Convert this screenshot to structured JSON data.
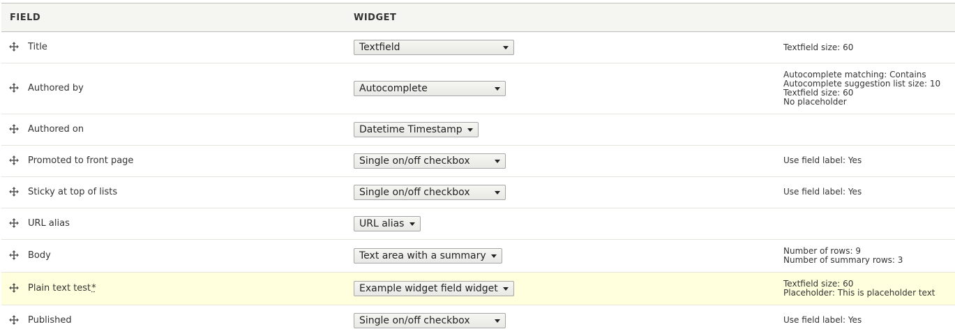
{
  "header": {
    "field": "FIELD",
    "widget": "WIDGET"
  },
  "rows": [
    {
      "label": "Title",
      "widget": "Textfield",
      "summary": [
        "Textfield size: 60"
      ]
    },
    {
      "label": "Authored by",
      "widget": "Autocomplete",
      "summary": [
        "Autocomplete matching: Contains",
        "Autocomplete suggestion list size: 10",
        "Textfield size: 60",
        "No placeholder"
      ]
    },
    {
      "label": "Authored on",
      "widget": "Datetime Timestamp",
      "summary": []
    },
    {
      "label": "Promoted to front page",
      "widget": "Single on/off checkbox",
      "summary": [
        "Use field label: Yes"
      ]
    },
    {
      "label": "Sticky at top of lists",
      "widget": "Single on/off checkbox",
      "summary": [
        "Use field label: Yes"
      ]
    },
    {
      "label": "URL alias",
      "widget": "URL alias",
      "summary": []
    },
    {
      "label": "Body",
      "widget": "Text area with a summary",
      "summary": [
        "Number of rows: 9",
        "Number of summary rows: 3"
      ]
    },
    {
      "label": "Plain text test",
      "required_marker": "*",
      "widget": "Example widget field widget",
      "summary": [
        "Textfield size: 60",
        "Placeholder: This is placeholder text"
      ]
    },
    {
      "label": "Published",
      "widget": "Single on/off checkbox",
      "summary": [
        "Use field label: Yes"
      ]
    }
  ],
  "icons": {
    "drag": "move-arrows-icon",
    "select_caret": "caret-down-icon"
  },
  "colors": {
    "header_bg": "#f5f5f2",
    "highlight_row_bg": "#ffffdd",
    "border": "#bfbfba"
  }
}
